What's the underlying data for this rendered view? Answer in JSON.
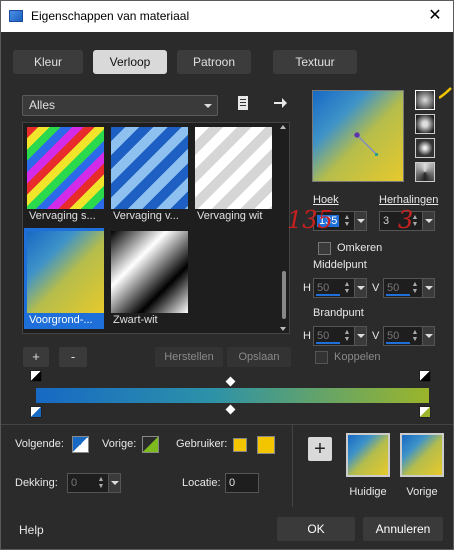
{
  "window": {
    "title": "Eigenschappen van materiaal",
    "close": "✕"
  },
  "tabs": [
    {
      "label": "Kleur",
      "active": false
    },
    {
      "label": "Verloop",
      "active": true
    },
    {
      "label": "Patroon",
      "active": false
    },
    {
      "label": "Textuur",
      "active": false
    }
  ],
  "category": {
    "selected": "Alles"
  },
  "gallery": {
    "items": [
      {
        "label": "Vervaging s...",
        "selected": false
      },
      {
        "label": "Vervaging v...",
        "selected": false
      },
      {
        "label": "Vervaging wit",
        "selected": false
      },
      {
        "label": "Voorgrond-...",
        "selected": true
      },
      {
        "label": "Zwart-wit",
        "selected": false
      }
    ]
  },
  "angle": {
    "label": "Hoek",
    "value": "135"
  },
  "repeats": {
    "label": "Herhalingen",
    "value": "3"
  },
  "invert": {
    "label": "Omkeren"
  },
  "center": {
    "label": "Middelpunt",
    "h_label": "H",
    "h_value": "50",
    "v_label": "V",
    "v_value": "50"
  },
  "focal": {
    "label": "Brandpunt",
    "h_label": "H",
    "h_value": "50",
    "v_label": "V",
    "v_value": "50"
  },
  "link": {
    "label": "Koppelen"
  },
  "buttons": {
    "add": "+",
    "remove": "-",
    "restore": "Herstellen",
    "save": "Opslaan"
  },
  "annotations": {
    "angle_note": "135",
    "repeat_note": "3"
  },
  "stops": {
    "next_label": "Volgende:",
    "prev_label": "Vorige:",
    "user_label": "Gebruiker:",
    "opacity_label": "Dekking:",
    "opacity_value": "0",
    "location_label": "Locatie:",
    "location_value": "0"
  },
  "swatches": {
    "current_label": "Huidige",
    "previous_label": "Vorige",
    "add_label": "+"
  },
  "footer": {
    "help": "Help",
    "ok": "OK",
    "cancel": "Annuleren"
  },
  "colors": {
    "blue": "#1769c4",
    "yellow": "#e7c92c",
    "accent": "#1e6fd9",
    "red_note": "#c72020"
  }
}
